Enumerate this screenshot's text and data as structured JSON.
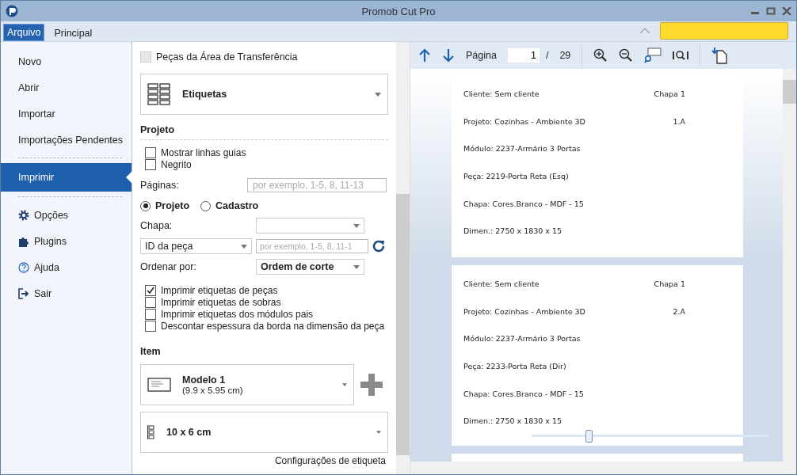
{
  "window": {
    "title": "Promob Cut Pro"
  },
  "ribbon_tabs": [
    {
      "label": "Arquivo",
      "selected": true
    },
    {
      "label": "Principal",
      "selected": false
    }
  ],
  "sidebar": {
    "groups": [
      [
        {
          "label": "Novo",
          "selected": false
        },
        {
          "label": "Abrir",
          "selected": false
        },
        {
          "label": "Importar",
          "selected": false
        },
        {
          "label": "Importações Pendentes",
          "selected": false
        }
      ],
      [
        {
          "label": "Imprimir",
          "selected": true
        }
      ],
      [
        {
          "label": "Opções",
          "selected": false
        },
        {
          "label": "Plugins",
          "selected": false
        },
        {
          "label": "Ajuda",
          "selected": false
        },
        {
          "label": "Sair",
          "selected": false
        }
      ]
    ]
  },
  "print_panel": {
    "top_checkbox": {
      "label": "Peças da Área de Transferência",
      "checked": false,
      "disabled": true
    },
    "report": {
      "value": "Etiquetas"
    },
    "project_section": {
      "title": "Projeto",
      "options": [
        {
          "label": "Mostrar linhas guias",
          "checked": false
        },
        {
          "label": "Negrito",
          "checked": false
        }
      ],
      "pages": {
        "label": "Páginas:",
        "placeholder": "por exemplo, 1-5, 8, 11-13"
      },
      "source": [
        {
          "label": "Projeto",
          "selected": true
        },
        {
          "label": "Cadastro",
          "selected": false
        }
      ],
      "sheet": {
        "label": "Chapa:"
      },
      "filter": {
        "value": "ID da peça",
        "placeholder": "por exemplo, 1-5, 8, 11-1"
      },
      "order": {
        "label": "Ordenar por:",
        "value": "Ordem de corte"
      },
      "print_options": [
        {
          "label": "Imprimir etiquetas de peças",
          "checked": true
        },
        {
          "label": "Imprimir etiquetas de sobras",
          "checked": false
        },
        {
          "label": "Imprimir etiquetas dos módulos pais",
          "checked": false
        },
        {
          "label": "Descontar espessura da borda na dimensão da peça",
          "checked": false
        }
      ]
    },
    "item_section": {
      "title": "Item",
      "model": {
        "name": "Modelo 1",
        "size": "(9.9 x 5.95 cm)"
      },
      "label_size": "10 x 6 cm",
      "settings_link": "Configurações de etiqueta"
    }
  },
  "preview": {
    "toolbar": {
      "page_label": "Página",
      "page": "1",
      "separator": "/",
      "total": "29"
    },
    "pages": [
      {
        "lines": [
          {
            "left": "Cliente: Sem cliente",
            "right": "Chapa 1"
          },
          {
            "left": "Projeto: Cozinhas - Ambiente 3D",
            "right": "1.A"
          },
          {
            "left": "Módulo: 2237-Armário 3 Portas"
          },
          {
            "left": "Peça: 2219-Porta Reta (Esq)"
          },
          {
            "left": "Chapa: Cores.Branco - MDF - 15"
          },
          {
            "left": "Dimen.: 2750 x 1830 x 15"
          }
        ]
      },
      {
        "lines": [
          {
            "left": "Cliente: Sem cliente",
            "right": "Chapa 1"
          },
          {
            "left": "Projeto: Cozinhas - Ambiente 3D",
            "right": "2.A"
          },
          {
            "left": "Módulo: 2237-Armário 3 Portas"
          },
          {
            "left": "Peça: 2233-Porta Reta (Dir)"
          },
          {
            "left": "Chapa: Cores.Branco - MDF - 15"
          },
          {
            "left": "Dimen.: 2750 x 1830 x 15"
          }
        ]
      }
    ],
    "zoom": {
      "level": 0.24
    }
  }
}
